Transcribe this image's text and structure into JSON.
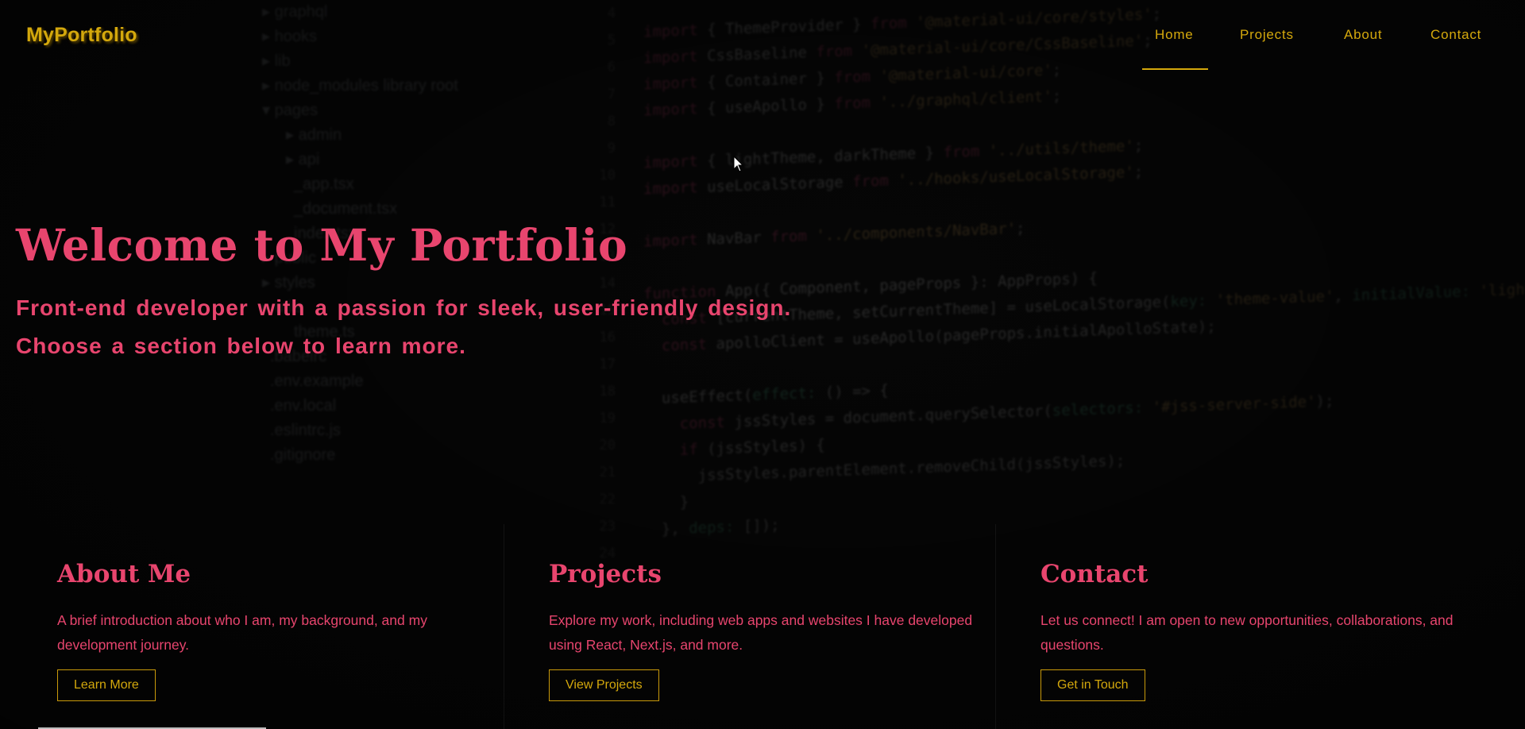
{
  "logo": "MyPortfolio",
  "nav": {
    "links": [
      "Home",
      "Projects",
      "About",
      "Contact"
    ],
    "active": "Home"
  },
  "hero": {
    "title": "Welcome to My Portfolio",
    "subtitle_line1": "Front-end developer with a passion for sleek, user-friendly design.",
    "subtitle_line2": "Choose a section below to learn more."
  },
  "cards": [
    {
      "title": "About Me",
      "description": "A brief introduction about who I am, my background, and my development journey.",
      "button": "Learn More"
    },
    {
      "title": "Projects",
      "description": "Explore my work, including web apps and websites I have developed using React, Next.js, and more.",
      "button": "View Projects"
    },
    {
      "title": "Contact",
      "description": "Let us connect! I am open to new opportunities, collaborations, and questions.",
      "button": "Get in Touch"
    }
  ],
  "colors": {
    "accent_pink": "#e8456e",
    "accent_gold": "#d4a80c",
    "background": "#070707"
  }
}
